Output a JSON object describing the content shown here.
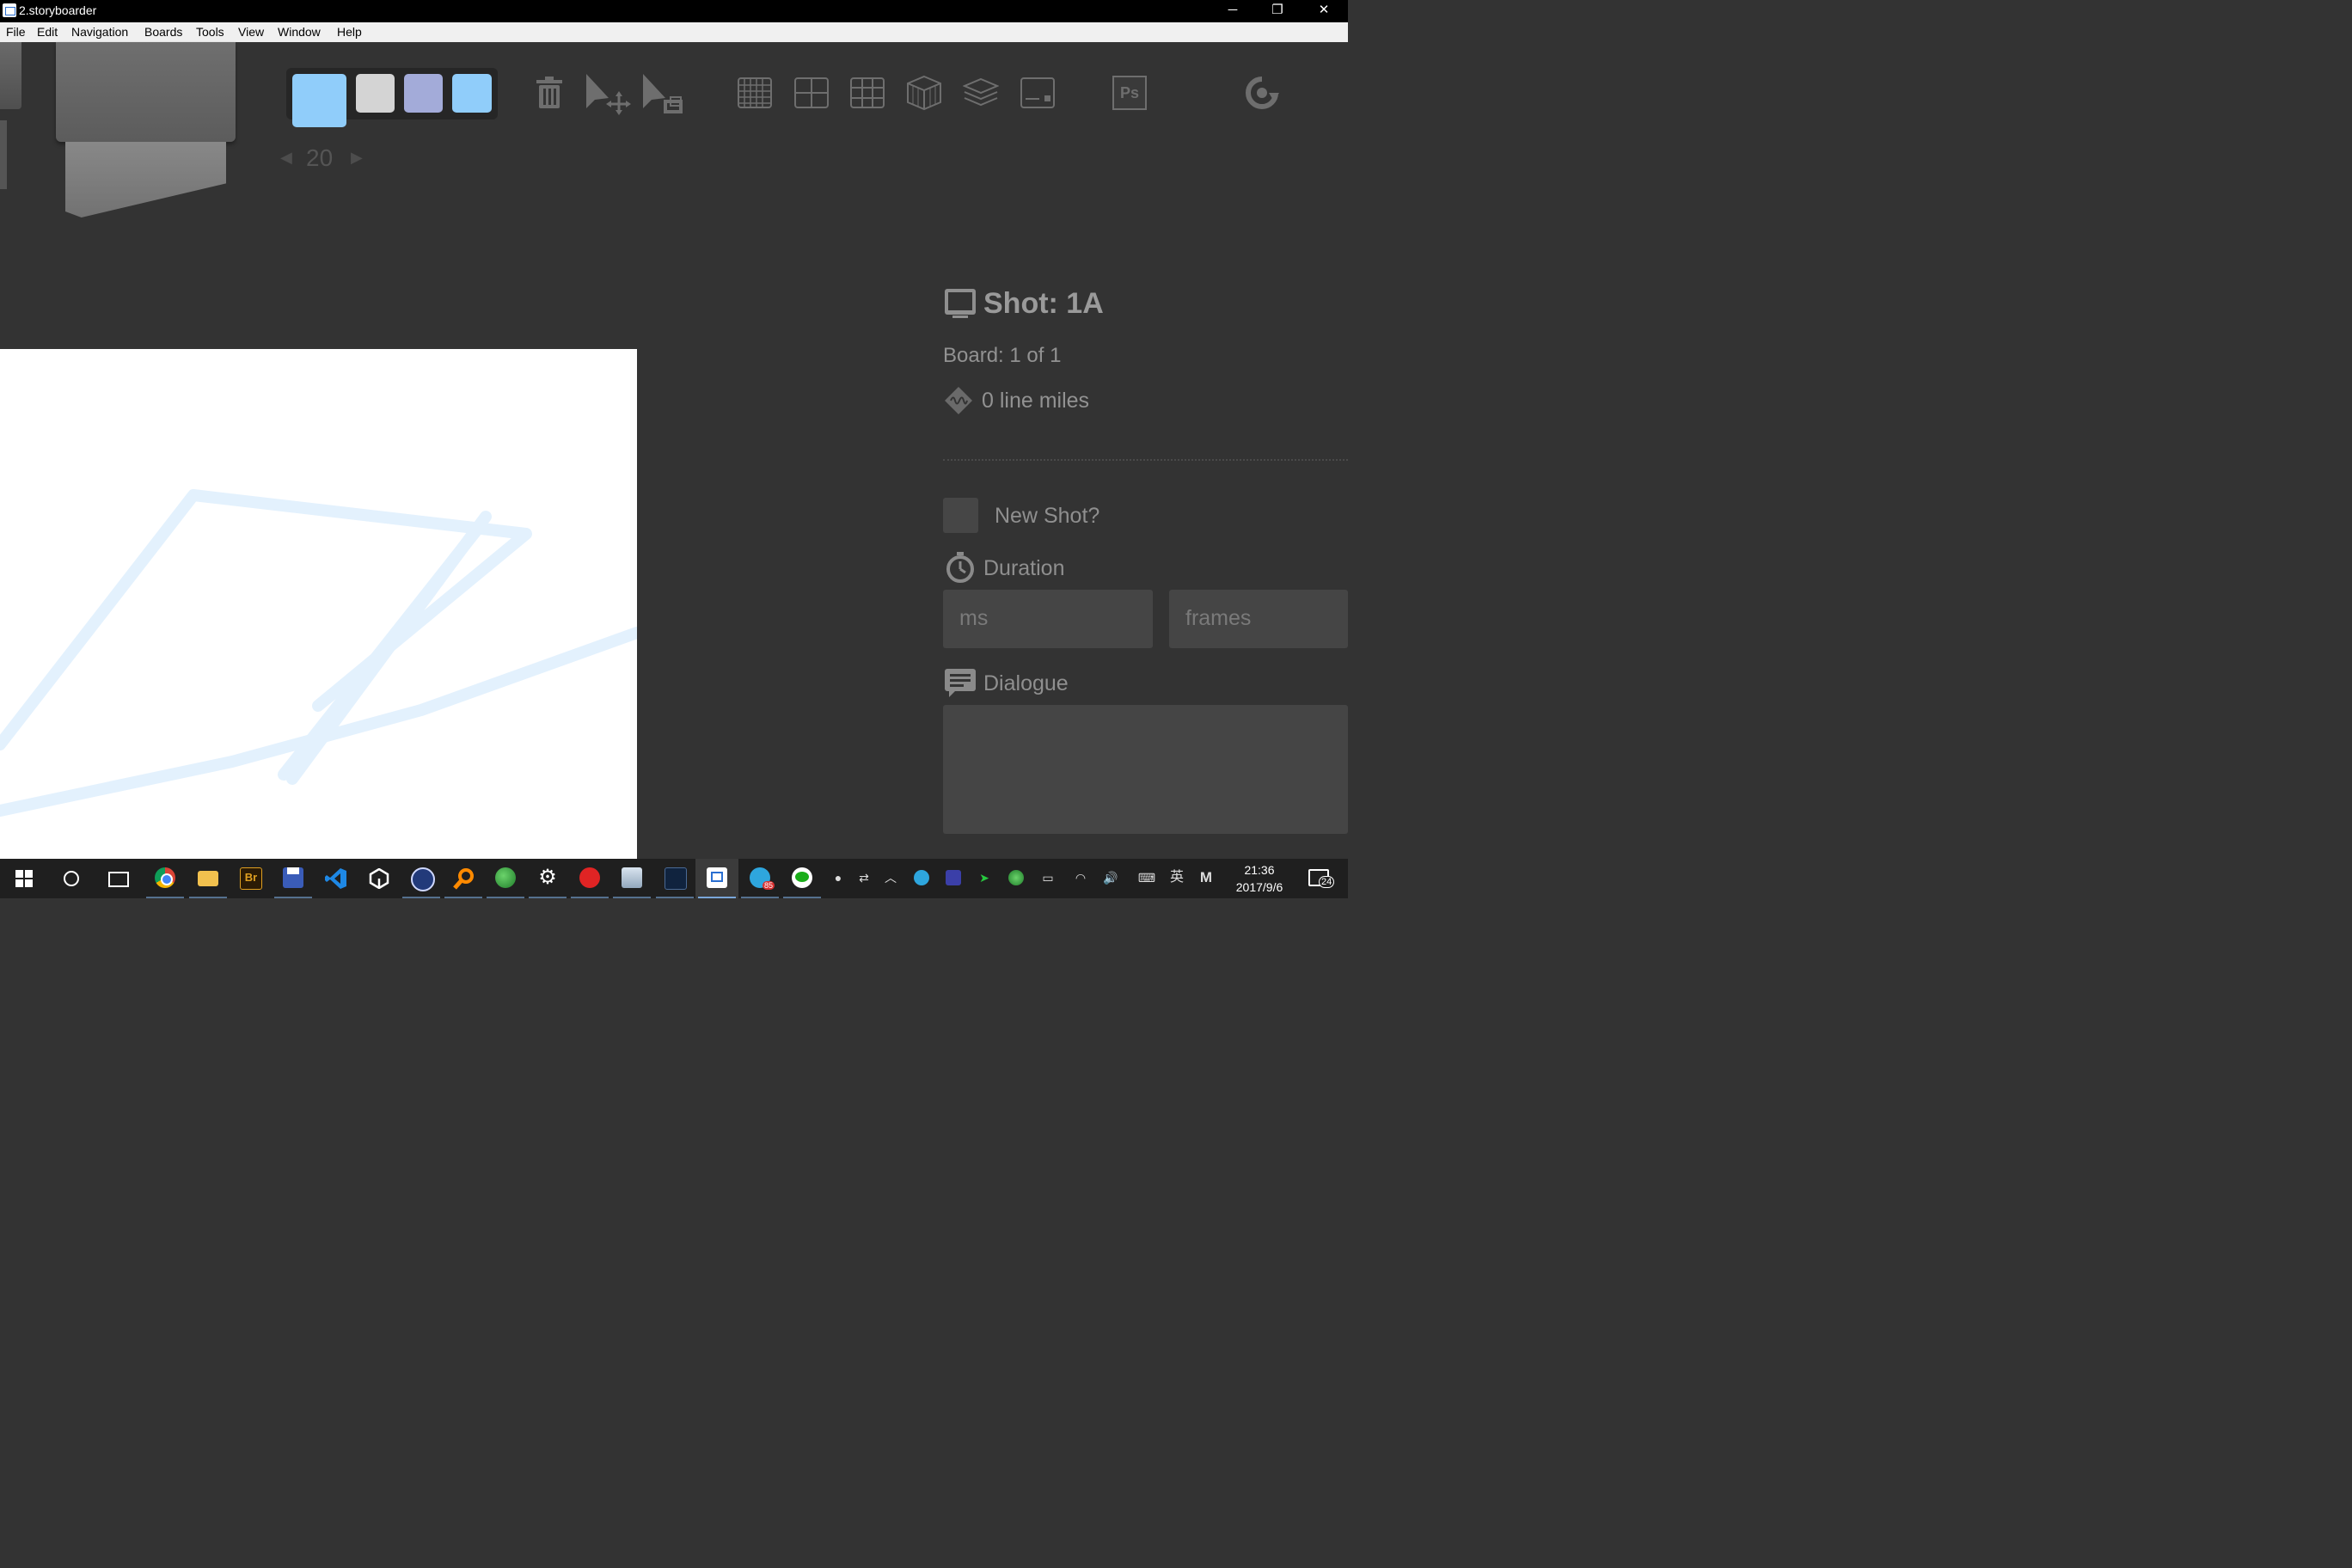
{
  "window": {
    "title": "2.storyboarder",
    "minimize": "─",
    "restore": "❐",
    "close": "✕"
  },
  "menu": [
    "File",
    "Edit",
    "Navigation",
    "Boards",
    "Tools",
    "View",
    "Window",
    "Help"
  ],
  "palette": {
    "colors": [
      "#90cdfa",
      "#d4d4d4",
      "#a3abd9",
      "#90cdfa"
    ],
    "size_label": "20",
    "prev_arrow": "◀",
    "next_arrow": "▶"
  },
  "toolbar": {
    "icons": [
      "trash-icon",
      "move-icon",
      "scale-icon",
      "grid-icon",
      "center-icon",
      "thirds-icon",
      "perspective-icon",
      "layers-icon",
      "caption-icon",
      "photoshop-icon",
      "refresh-icon"
    ],
    "ps_label": "Ps"
  },
  "sidebar": {
    "shot_title": "Shot: 1A",
    "board_count": "Board: 1 of 1",
    "line_miles": "0 line miles",
    "new_shot_label": "New Shot?",
    "duration_label": "Duration",
    "ms_placeholder": "ms",
    "frames_placeholder": "frames",
    "dialogue_label": "Dialogue"
  },
  "taskbar": {
    "apps": [
      "windows-start",
      "cortana",
      "task-view",
      "chrome",
      "file-explorer",
      "bridge",
      "save-app",
      "vscode",
      "unity",
      "cinema4d",
      "search-tool",
      "earth-app",
      "settings",
      "netease-music",
      "photo-app",
      "kindle",
      "storyboarder",
      "telegram",
      "wechat"
    ],
    "badge_telegram": "85",
    "tray_ime": "英",
    "tray_m": "M",
    "time": "21:36",
    "date": "2017/9/6",
    "notifications": "24",
    "accent": "#7aa6d9"
  }
}
